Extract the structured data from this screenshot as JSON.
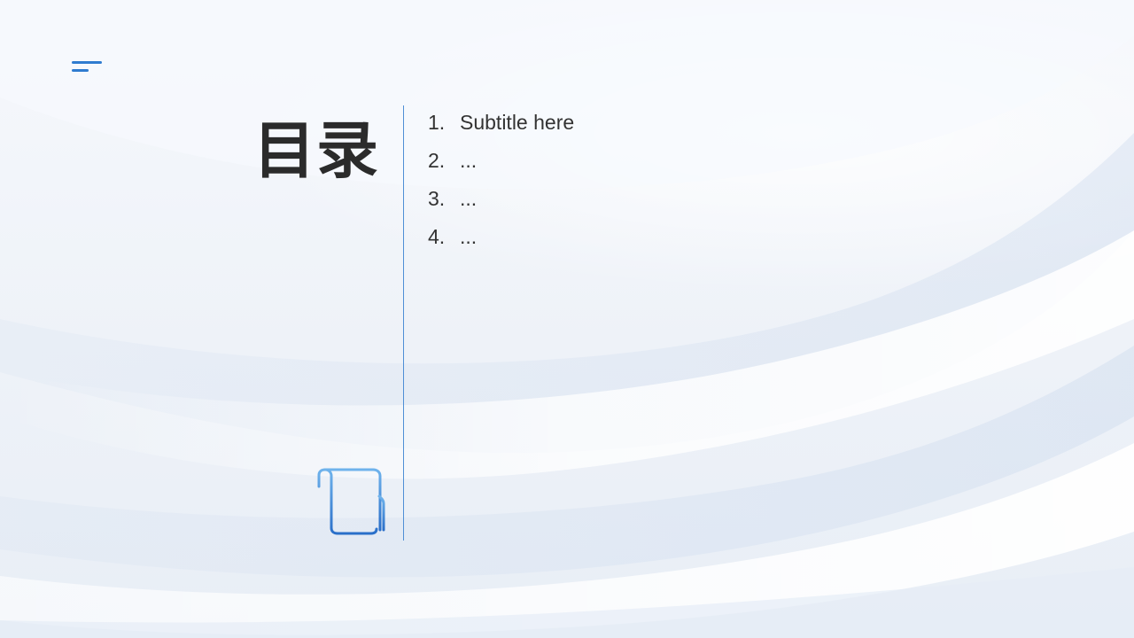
{
  "slide": {
    "title": "目录",
    "items": [
      {
        "number": "1.",
        "label": "Subtitle here"
      },
      {
        "number": "2.",
        "label": "..."
      },
      {
        "number": "3.",
        "label": "..."
      },
      {
        "number": "4.",
        "label": "..."
      }
    ]
  },
  "icons": {
    "menu": "menu-icon",
    "document": "scroll-document-icon"
  },
  "colors": {
    "accent": "#2f7cd0",
    "text": "#333333",
    "title": "#2b2b2b",
    "background": "#f2f5fa"
  }
}
